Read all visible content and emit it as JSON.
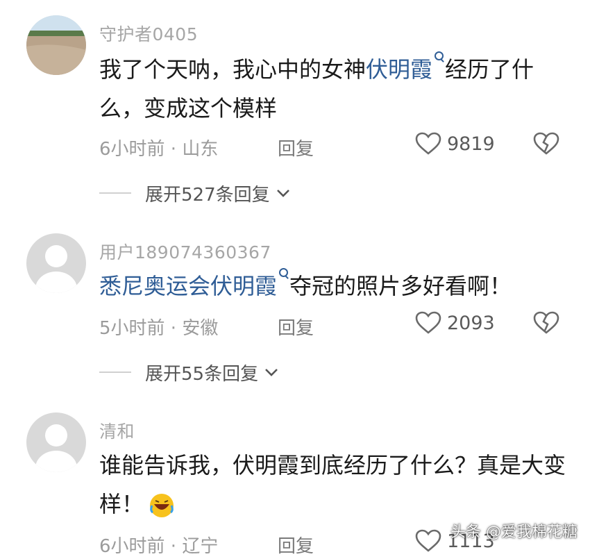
{
  "comments": [
    {
      "username": "守护者0405",
      "text_before": "我了个天呐，我心中的女神",
      "link": "伏明霞",
      "text_after": "经历了什么，变成这个模样",
      "time_location": "6小时前 · 山东",
      "reply_label": "回复",
      "likes": "9819",
      "expand_label": "展开527条回复"
    },
    {
      "username": "用户189074360367",
      "text_before": "",
      "link": "悉尼奥运会伏明霞",
      "text_after": "夺冠的照片多好看啊！",
      "time_location": "5小时前 · 安徽",
      "reply_label": "回复",
      "likes": "2093",
      "expand_label": "展开55条回复"
    },
    {
      "username": "清和",
      "text": "谁能告诉我，伏明霞到底经历了什么？真是大变样！",
      "time_location": "6小时前 · 辽宁",
      "reply_label": "回复",
      "likes": "1113"
    }
  ],
  "watermark": "头条 @爱我棉花糖",
  "colors": {
    "link": "#2f5d96",
    "meta": "#9b9b9b",
    "username": "#a6a6a6"
  }
}
